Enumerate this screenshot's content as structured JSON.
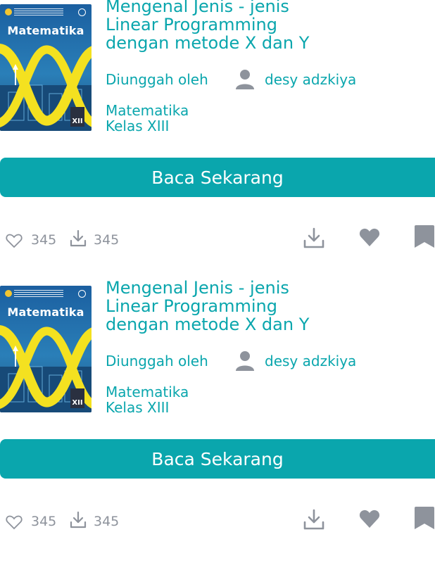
{
  "cards": [
    {
      "cover": {
        "title": "Matematika",
        "grade_badge": "XII"
      },
      "title_lines": [
        "Mengenal Jenis - jenis",
        "Linear Programming",
        "dengan metode X dan Y"
      ],
      "uploaded_label": "Diunggah oleh",
      "author": "desy adzkiya",
      "subject": "Matematika",
      "grade": "Kelas XIII",
      "read_button": "Baca Sekarang",
      "likes": "345",
      "downloads": "345"
    },
    {
      "cover": {
        "title": "Matematika",
        "grade_badge": "XII"
      },
      "title_lines": [
        "Mengenal Jenis - jenis",
        "Linear Programming",
        "dengan metode X dan Y"
      ],
      "uploaded_label": "Diunggah oleh",
      "author": "desy adzkiya",
      "subject": "Matematika",
      "grade": "Kelas XIII",
      "read_button": "Baca Sekarang",
      "likes": "345",
      "downloads": "345"
    }
  ],
  "colors": {
    "accent": "#0aa6ad",
    "muted_icon": "#8e939c",
    "stat_text": "#8e939c"
  },
  "icons": [
    "user-icon",
    "heart-outline-icon",
    "download-icon",
    "heart-filled-icon",
    "bookmark-icon"
  ]
}
